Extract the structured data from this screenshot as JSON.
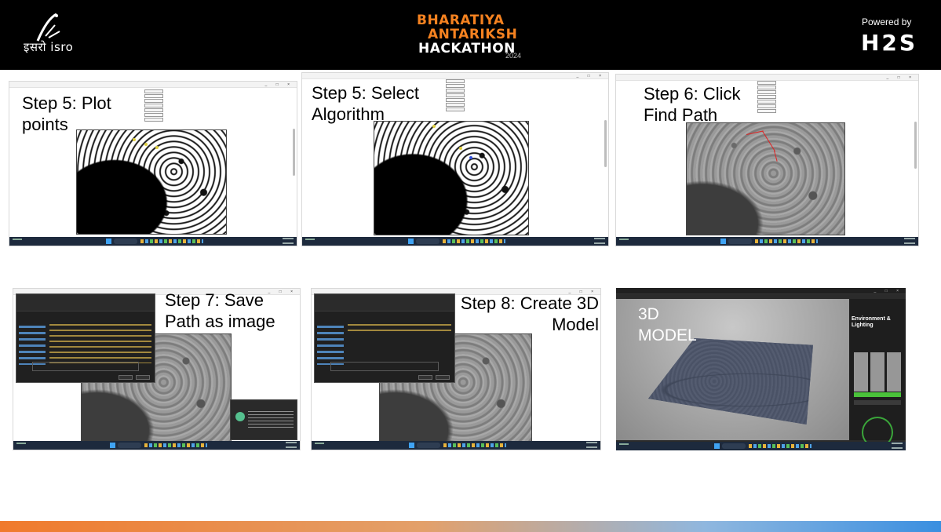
{
  "header": {
    "isro_text": "इसरो isro",
    "hackathon_line1": "BHARATIYA",
    "hackathon_line2": "ANTARIKSH",
    "hackathon_line3": "HACKATHON",
    "hackathon_year": "2024",
    "powered_by": "Powered by",
    "sponsor": "H2S"
  },
  "steps": [
    {
      "label_line1": "Step 5: Plot",
      "label_line2": "points"
    },
    {
      "label_line1": "Step 5: Select",
      "label_line2": "Algorithm"
    },
    {
      "label_line1": "Step 6: Click",
      "label_line2": "Find Path"
    },
    {
      "label_line1": "Step 7: Save",
      "label_line2": "Path as image"
    },
    {
      "label_line1": "Step 8: Create 3D",
      "label_line2": "Model"
    },
    {
      "label_line1": "3D",
      "label_line2": "MODEL"
    }
  ],
  "viewer": {
    "side_title_line1": "Environment &",
    "side_title_line2": "Lighting"
  },
  "colors": {
    "header_bg": "#000000",
    "accent_orange": "#f58220",
    "accent_blue": "#3a8fe0",
    "path_red": "#e02020"
  },
  "icons": [
    "isro-logo-icon",
    "windows-start-icon",
    "search-icon",
    "folder-icon",
    "whatsapp-icon"
  ]
}
